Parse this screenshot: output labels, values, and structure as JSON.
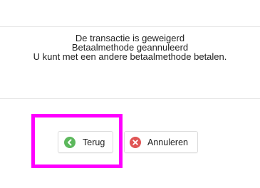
{
  "message": {
    "line1": "De transactie is geweigerd",
    "line2": "Betaalmethode geannuleerd",
    "line3": "U kunt met een andere betaalmethode betalen."
  },
  "buttons": {
    "back_label": "Terug",
    "cancel_label": "Annuleren",
    "back_icon": "chevron-left-icon",
    "cancel_icon": "close-icon"
  },
  "colors": {
    "back_icon": "#5cb85c",
    "cancel_icon": "#e05555",
    "highlight": "#ff00ff"
  }
}
